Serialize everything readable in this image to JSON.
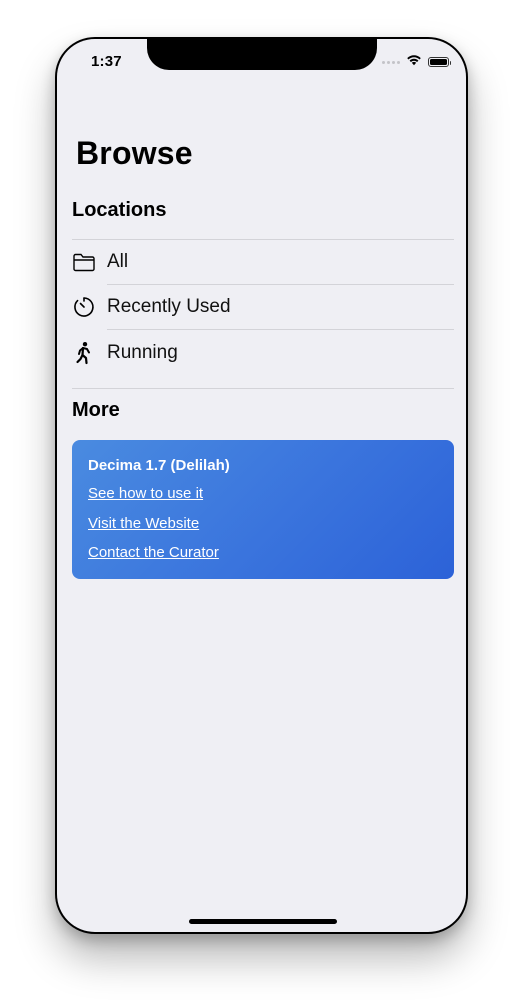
{
  "status_bar": {
    "time": "1:37",
    "icons": [
      "signal-dots-icon",
      "wifi-icon",
      "battery-icon"
    ]
  },
  "page": {
    "title": "Browse"
  },
  "locations": {
    "header": "Locations",
    "items": [
      {
        "label": "All",
        "icon": "folder-icon"
      },
      {
        "label": "Recently Used",
        "icon": "timer-icon"
      },
      {
        "label": "Running",
        "icon": "walking-figure-icon"
      }
    ]
  },
  "more": {
    "header": "More",
    "card": {
      "title": "Decima 1.7 (Delilah)",
      "links": [
        "See how to use it",
        "Visit the Website",
        "Contact the Curator"
      ],
      "gradient_start": "#4a8be0",
      "gradient_end": "#2c62d8"
    }
  }
}
